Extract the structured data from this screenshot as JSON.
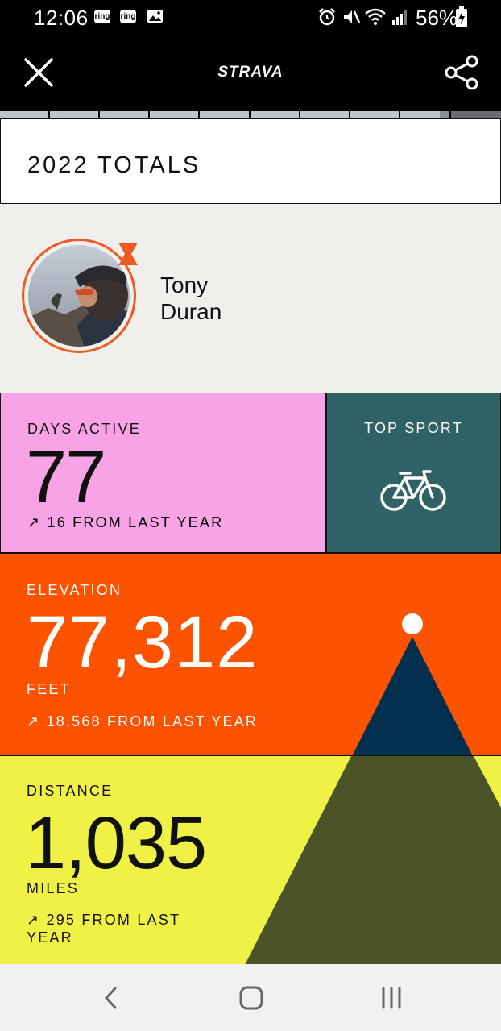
{
  "status_bar": {
    "time": "12:06",
    "ring_icon_1": "ring",
    "ring_icon_2": "ring",
    "battery": "56%"
  },
  "app_bar": {
    "brand": "STRAVA"
  },
  "title": "2022 TOTALS",
  "profile": {
    "first_name": "Tony",
    "last_name": "Duran"
  },
  "days_active": {
    "label": "DAYS ACTIVE",
    "value": "77",
    "delta": "16 FROM LAST YEAR"
  },
  "top_sport": {
    "label": "TOP SPORT",
    "icon": "bicycle-icon"
  },
  "elevation": {
    "label": "ELEVATION",
    "value": "77,312",
    "unit": "FEET",
    "delta": "18,568 FROM LAST YEAR"
  },
  "distance": {
    "label": "DISTANCE",
    "value": "1,035",
    "unit": "MILES",
    "delta": "295 FROM LAST YEAR"
  },
  "colors": {
    "days_bg": "#f9a3e7",
    "sport_bg": "#2e6266",
    "elevation_bg": "#fd5200",
    "distance_bg": "#eff244",
    "mountain_top": "#032f4f",
    "mountain_base": "#4b5428",
    "accent": "#ef5a24"
  }
}
